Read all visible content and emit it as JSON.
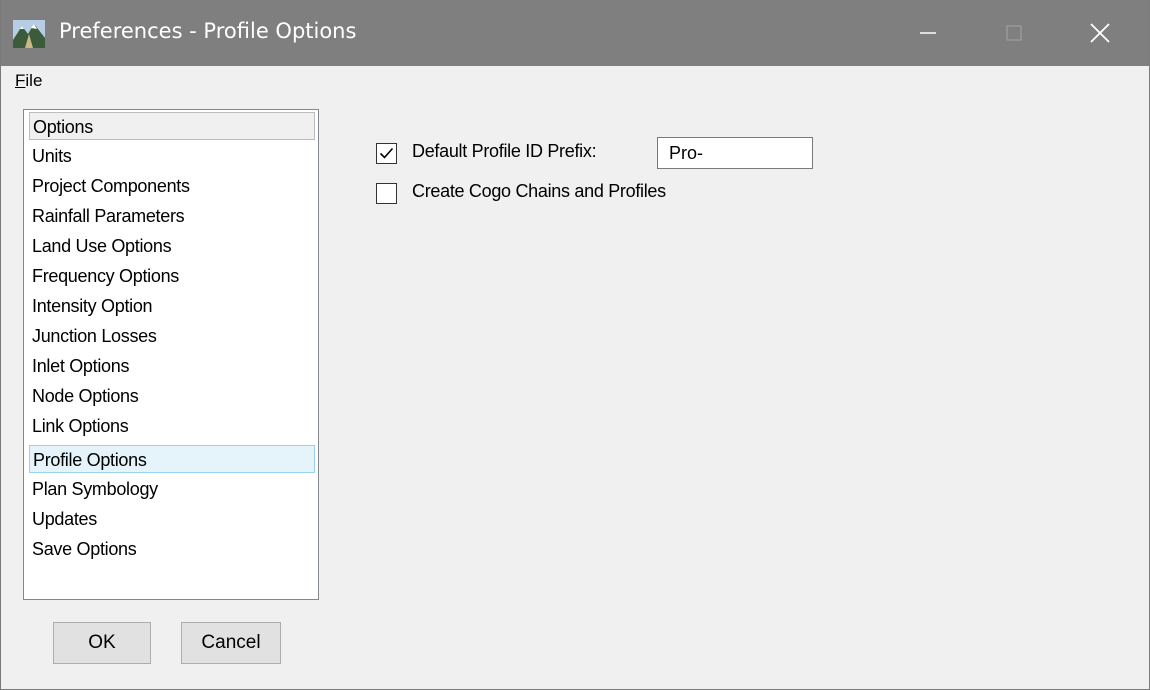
{
  "window": {
    "title": "Preferences - Profile Options",
    "icon": "mountain-app-icon"
  },
  "menu": {
    "file_label": "File"
  },
  "options_list": {
    "header": "Options",
    "selected": "Profile Options",
    "items": [
      "Units",
      "Project Components",
      "Rainfall Parameters",
      "Land Use Options",
      "Frequency Options",
      "Intensity Option",
      "Junction Losses",
      "Inlet Options",
      "Node Options",
      "Link Options",
      "Profile Options",
      "Plan Symbology",
      "Updates",
      "Save Options"
    ]
  },
  "buttons": {
    "ok_label": "OK",
    "cancel_label": "Cancel"
  },
  "profile_options": {
    "default_prefix_label": "Default Profile ID Prefix:",
    "default_prefix_checked": true,
    "default_prefix_value": "Pro-",
    "create_cogo_label": "Create Cogo Chains and Profiles",
    "create_cogo_checked": false
  },
  "colors": {
    "titlebar": "#7f7f7f",
    "selection_bg": "#e5f3fb",
    "selection_border": "#99d1ef"
  }
}
